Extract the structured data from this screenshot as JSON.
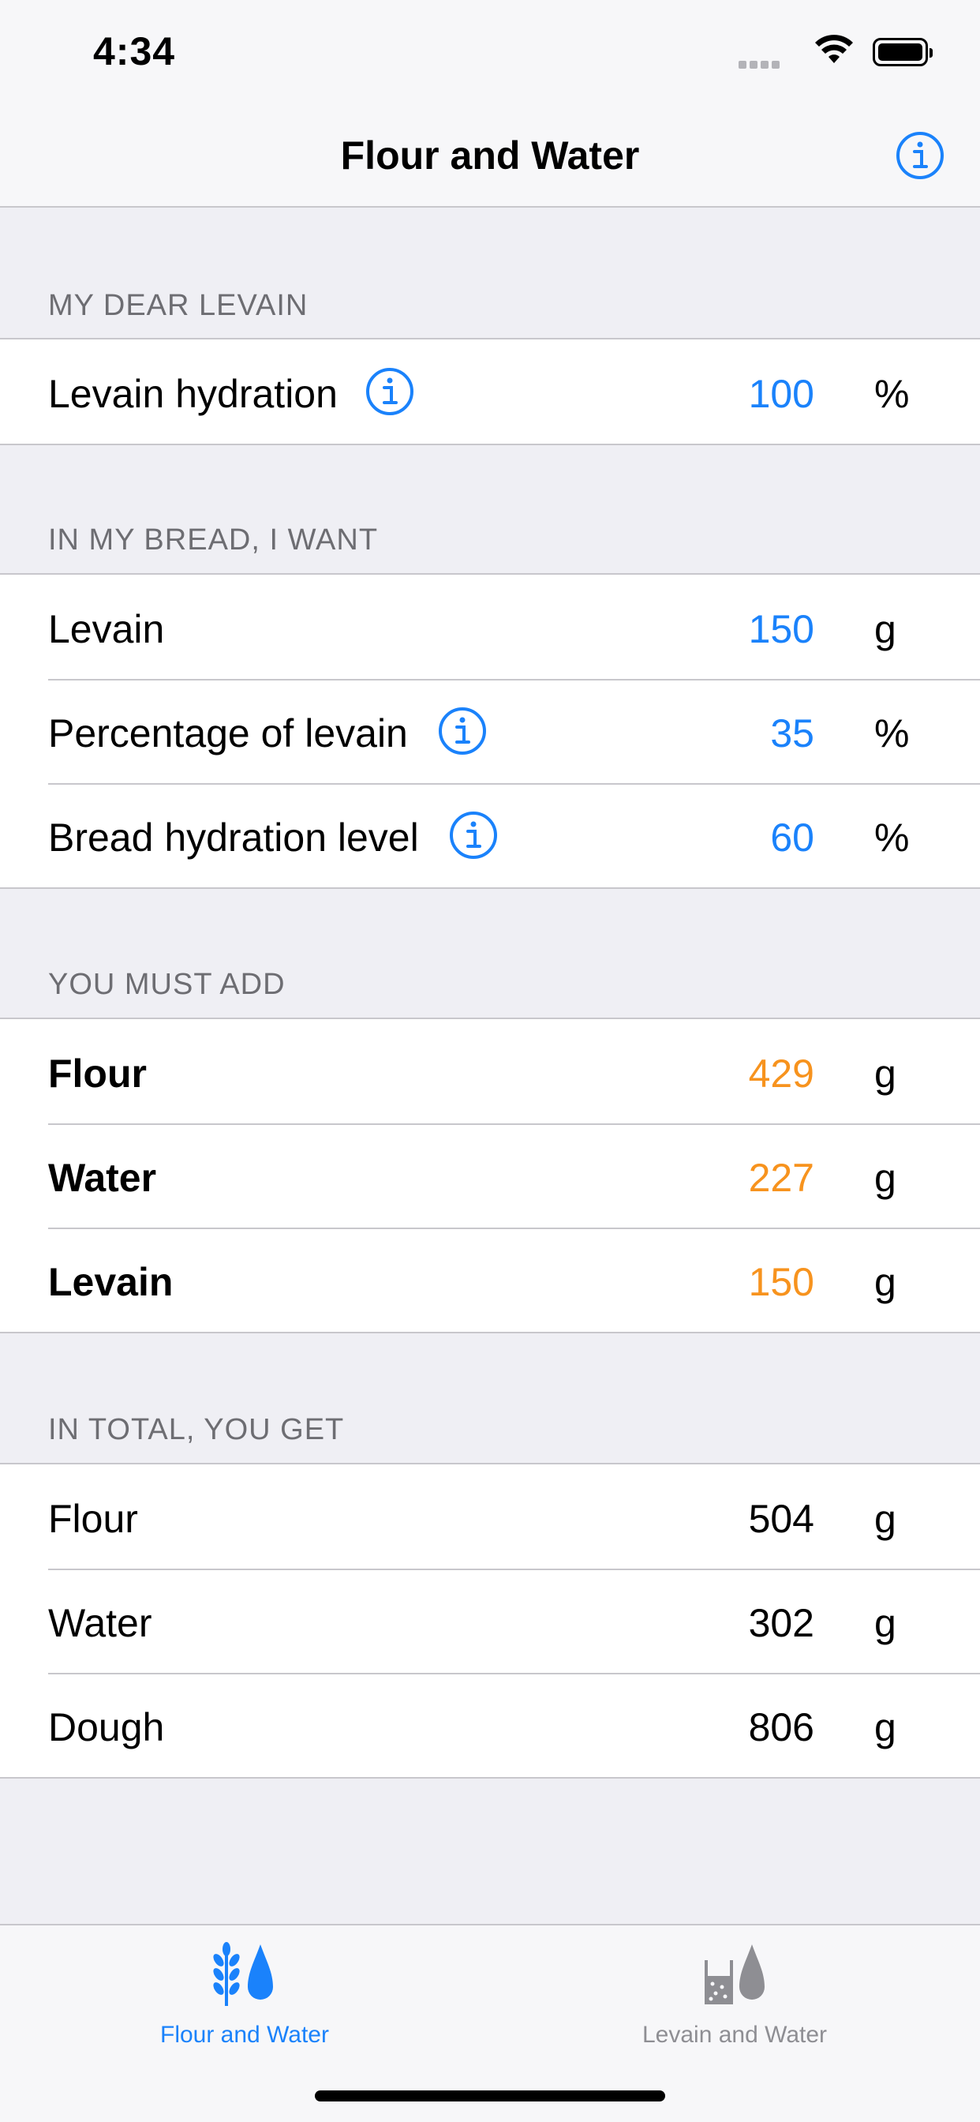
{
  "status_bar": {
    "time": "4:34"
  },
  "nav": {
    "title": "Flour and Water"
  },
  "sections": {
    "levain": {
      "header": "MY DEAR LEVAIN",
      "rows": [
        {
          "label": "Levain hydration",
          "value": "100",
          "unit": "%",
          "info": true
        }
      ]
    },
    "want": {
      "header": "IN MY BREAD, I WANT",
      "rows": [
        {
          "label": "Levain",
          "value": "150",
          "unit": "g"
        },
        {
          "label": "Percentage of levain",
          "value": "35",
          "unit": "%",
          "info": true
        },
        {
          "label": "Bread hydration level",
          "value": "60",
          "unit": "%",
          "info": true
        }
      ]
    },
    "add": {
      "header": "YOU MUST ADD",
      "rows": [
        {
          "label": "Flour",
          "value": "429",
          "unit": "g"
        },
        {
          "label": "Water",
          "value": "227",
          "unit": "g"
        },
        {
          "label": "Levain",
          "value": "150",
          "unit": "g"
        }
      ]
    },
    "total": {
      "header": "IN TOTAL, YOU GET",
      "rows": [
        {
          "label": "Flour",
          "value": "504",
          "unit": "g"
        },
        {
          "label": "Water",
          "value": "302",
          "unit": "g"
        },
        {
          "label": "Dough",
          "value": "806",
          "unit": "g"
        }
      ]
    }
  },
  "tabs": [
    {
      "label": "Flour and Water",
      "selected": true,
      "icon": "wheat-drop-icon"
    },
    {
      "label": "Levain and Water",
      "selected": false,
      "icon": "jar-drop-icon"
    }
  ],
  "colors": {
    "accent": "#1a82fb",
    "computed": "#f7931e",
    "inactive_tab": "#8e8e93"
  }
}
